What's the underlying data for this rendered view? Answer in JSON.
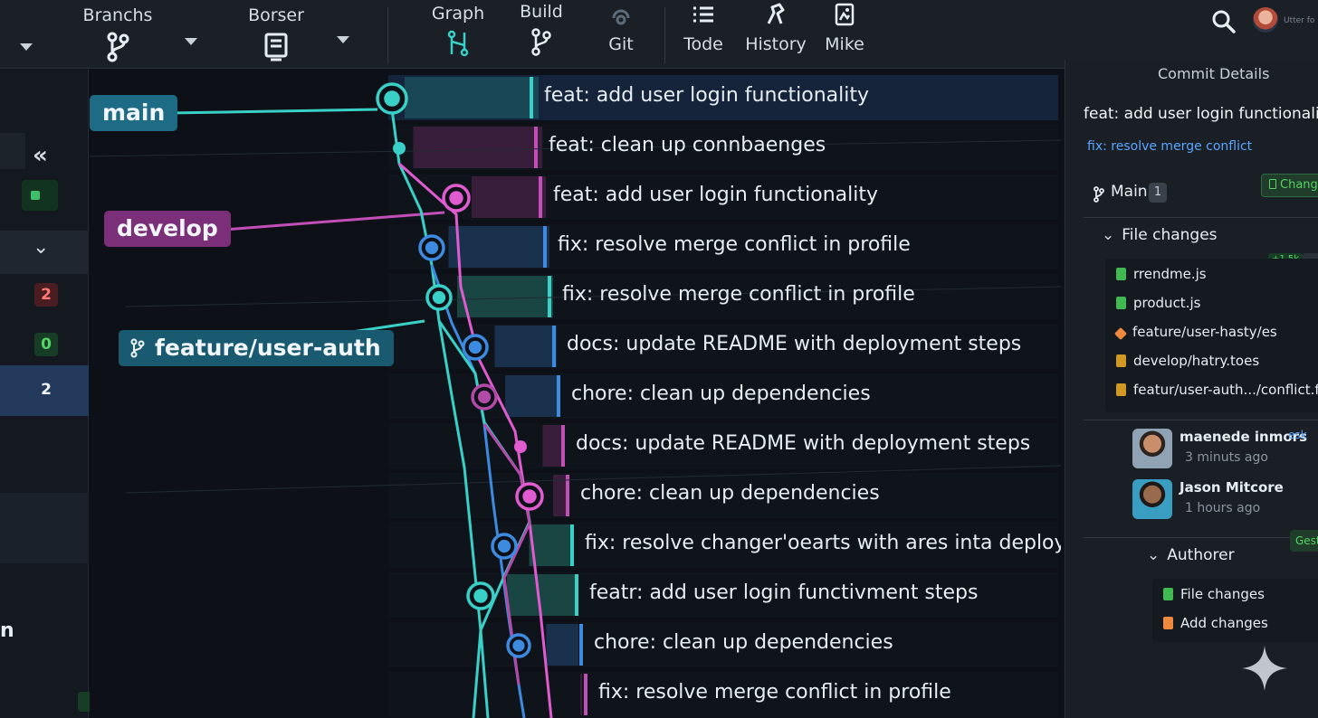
{
  "toolbar": {
    "items": [
      {
        "label": "Branchs",
        "icon": "branch-icon"
      },
      {
        "label": "Borser",
        "icon": "browser-icon"
      },
      {
        "label": "Graph",
        "icon": "graph-icon"
      },
      {
        "label": "Build",
        "icon": "build-icon"
      },
      {
        "label": "Git",
        "icon": "git-icon"
      },
      {
        "label": "Tode",
        "icon": "list-icon"
      },
      {
        "label": "History",
        "icon": "history-icon"
      },
      {
        "label": "Mike",
        "icon": "image-icon"
      }
    ],
    "user_label": "Utter fo"
  },
  "rail": {
    "counts": [
      {
        "value": "2",
        "style": "red"
      },
      {
        "value": "0",
        "style": "green"
      },
      {
        "value": "2",
        "style": "blue"
      }
    ],
    "partial_label": "n"
  },
  "graph": {
    "branches": [
      {
        "name": "main",
        "color": "#1d6b84"
      },
      {
        "name": "develop",
        "color": "#7a2f78"
      },
      {
        "name": "feature/user-auth",
        "color": "#1a5a70"
      }
    ],
    "commits": [
      "feat: add user login functionality",
      "feat: clean up connbaenges",
      "feat: add user login functionality",
      "fix: resolve merge conflict in profile",
      "fix: resolve merge conflict in profile",
      "docs: update README with deployment steps",
      "chore: clean up dependencies",
      "docs: update README with deployment steps",
      "chore: clean up dependencies",
      "fix: resolve changer'oearts with ares inta deployments",
      "featr: add user login functivment steps",
      "chore: clean up dependencies",
      "fix: resolve merge conflict in profile"
    ]
  },
  "details": {
    "title": "Commit Details",
    "commit_title": "feat: add user login functionality",
    "commit_sub": "fix: resolve merge conflict",
    "branch": "Main",
    "branch_count": "1",
    "changes_button": "Changes",
    "file_changes_label": "File changes",
    "files": [
      {
        "name": "rrendme.js",
        "icon_color": "#3fb950"
      },
      {
        "name": "product.js",
        "icon_color": "#3fb950"
      },
      {
        "name": "feature/user-hasty/es",
        "icon_color": "#f0883e"
      },
      {
        "name": "develop/hatry.toes",
        "icon_color": "#d29922"
      },
      {
        "name": "featur/user-auth.../conflict.fix",
        "icon_color": "#d29922"
      }
    ],
    "diff_badge": "+1.5k",
    "people": [
      {
        "name": "maenede inmors",
        "time": "3 minuts ago",
        "tag": "esk"
      },
      {
        "name": "Jason Mitcore",
        "time": "1 hours ago"
      }
    ],
    "authorer_label": "Authorer",
    "gest_button": "Gest",
    "author_items": [
      "File changes",
      "Add changes"
    ]
  }
}
